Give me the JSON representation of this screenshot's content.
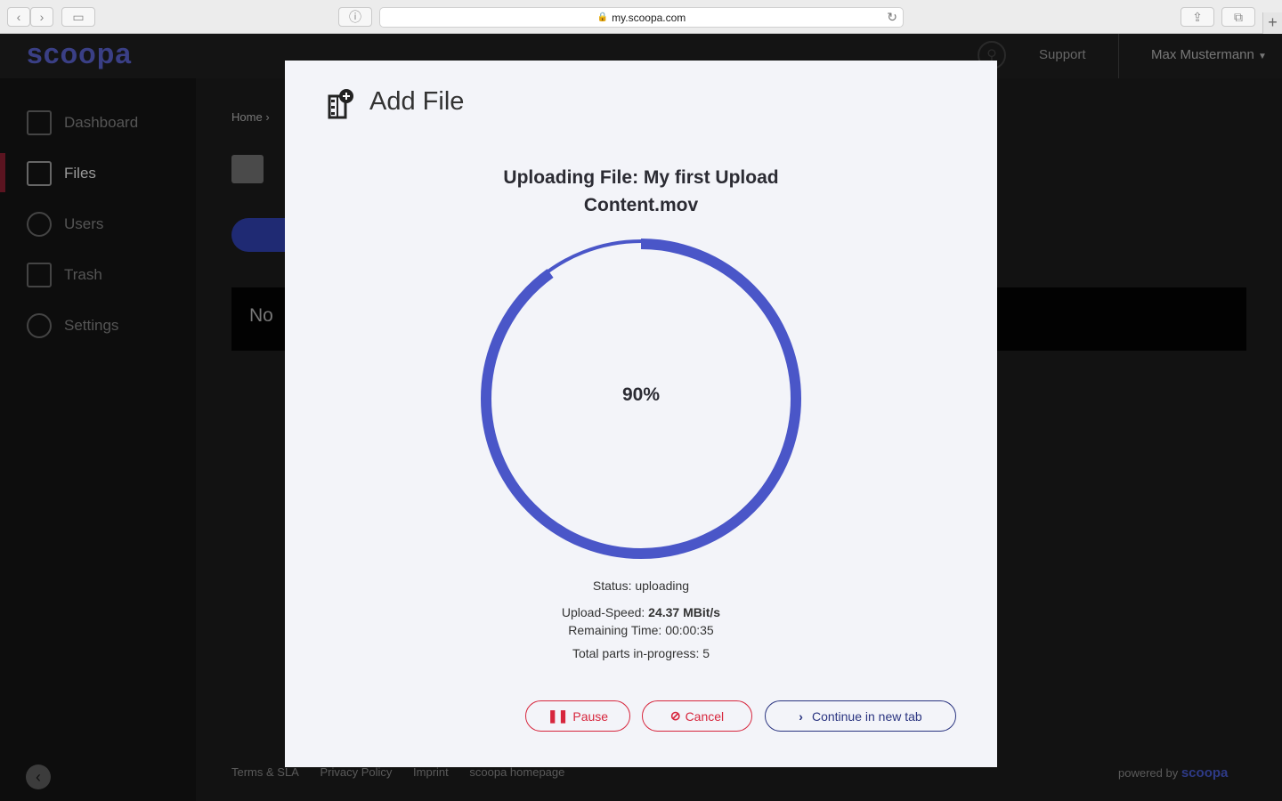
{
  "browser": {
    "url": "my.scoopa.com"
  },
  "header": {
    "logo": "scoopa",
    "support_label": "Support",
    "user_name": "Max Mustermann"
  },
  "sidebar": {
    "items": [
      {
        "label": "Dashboard",
        "icon": "dashboard-icon"
      },
      {
        "label": "Files",
        "icon": "file-icon"
      },
      {
        "label": "Users",
        "icon": "users-icon"
      },
      {
        "label": "Trash",
        "icon": "trash-icon"
      },
      {
        "label": "Settings",
        "icon": "gear-icon"
      }
    ]
  },
  "main": {
    "breadcrumb": "Home",
    "empty_text": "No",
    "footer_links": [
      "Terms & SLA",
      "Privacy Policy",
      "Imprint",
      "scoopa homepage"
    ],
    "powered_by": "powered by",
    "powered_brand": "scoopa"
  },
  "modal": {
    "title": "Add File",
    "upload_title": "Uploading File: My first Upload Content.mov",
    "progress_label": "90%",
    "progress_fraction": 0.9,
    "status": "Status: uploading",
    "speed_label": "Upload-Speed: ",
    "speed_value": "24.37 MBit/s",
    "remaining": "Remaining Time: 00:00:35",
    "parts": "Total parts in-progress: 5",
    "pause_label": "Pause",
    "cancel_label": "Cancel",
    "continue_label": "Continue in new tab"
  },
  "colors": {
    "accent": "#4a56c8",
    "danger": "#d7263d",
    "navy": "#2a3480"
  }
}
